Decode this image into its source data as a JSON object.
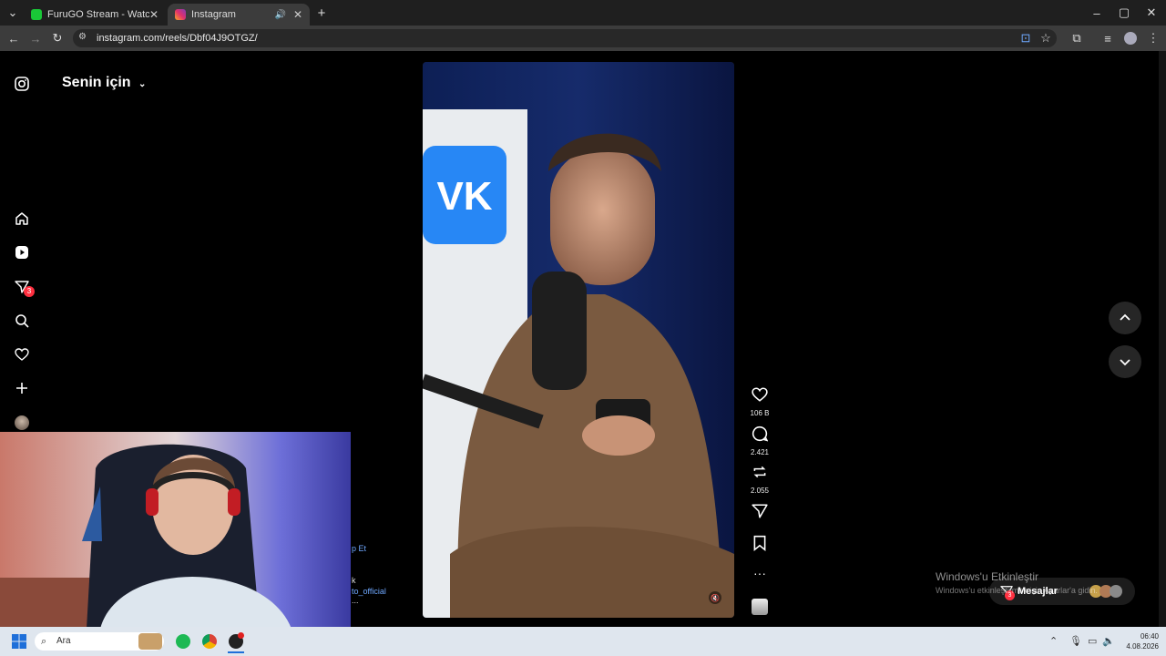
{
  "browser": {
    "tabs": [
      {
        "title": "FuruGO Stream - Watch Live or",
        "active": false
      },
      {
        "title": "Instagram",
        "active": true
      }
    ],
    "new_tab": "+",
    "url": "instagram.com/reels/Dbf04J9OTGZ/"
  },
  "instagram": {
    "feed_title": "Senin için",
    "notifications_badge": "3",
    "actions": {
      "likes": "106 B",
      "comments": "2.421",
      "reposts": "2.055"
    },
    "left_fragments": [
      "p Et",
      "k",
      "to_official",
      "..."
    ],
    "messages_label": "Mesajlar",
    "messages_badge": "3"
  },
  "windows": {
    "activation_title": "Windows'u Etkinleştir",
    "activation_sub": "Windows'u etkinleştirmek için Ayarlar'a gidin.",
    "search_placeholder": "Ara",
    "time": "06:40",
    "date": "4.08.2026"
  },
  "colors": {
    "badge": "#ff3040",
    "vk_blue": "#2787f5",
    "tabbar": "#1f1f1f",
    "toolbar": "#3c3c3c"
  }
}
